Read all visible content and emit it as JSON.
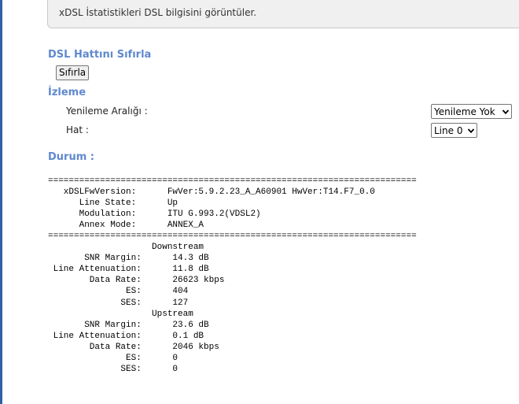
{
  "info": {
    "description": "xDSL İstatistikleri DSL bilgisini görüntüler."
  },
  "reset": {
    "section_title": "DSL Hattını Sıfırla",
    "button_label": "Sıfırla"
  },
  "monitoring": {
    "section_title": "İzleme",
    "refresh_label": "Yenileme Aralığı :",
    "refresh_value": "Yenileme Yok",
    "line_label": "Hat :",
    "line_value": "Line 0"
  },
  "status": {
    "section_title": "Durum :",
    "lines": [
      "=======================================================================",
      "   xDSLFwVersion:      FwVer:5.9.2.23_A_A60901 HwVer:T14.F7_0.0",
      "      Line State:      Up",
      "      Modulation:      ITU G.993.2(VDSL2)",
      "      Annex Mode:      ANNEX_A",
      "=======================================================================",
      "                    Downstream",
      "       SNR Margin:      14.3 dB",
      " Line Attenuation:      11.8 dB",
      "        Data Rate:      26623 kbps",
      "               ES:      404",
      "              SES:      127",
      "                    Upstream",
      "       SNR Margin:      23.6 dB",
      " Line Attenuation:      0.1 dB",
      "        Data Rate:      2046 kbps",
      "               ES:      0",
      "              SES:      0"
    ]
  },
  "colors": {
    "section_title": "#5f89cf",
    "left_rule": "#2f5fa8"
  },
  "icons": {
    "dropdown": "chevron-down-icon"
  }
}
